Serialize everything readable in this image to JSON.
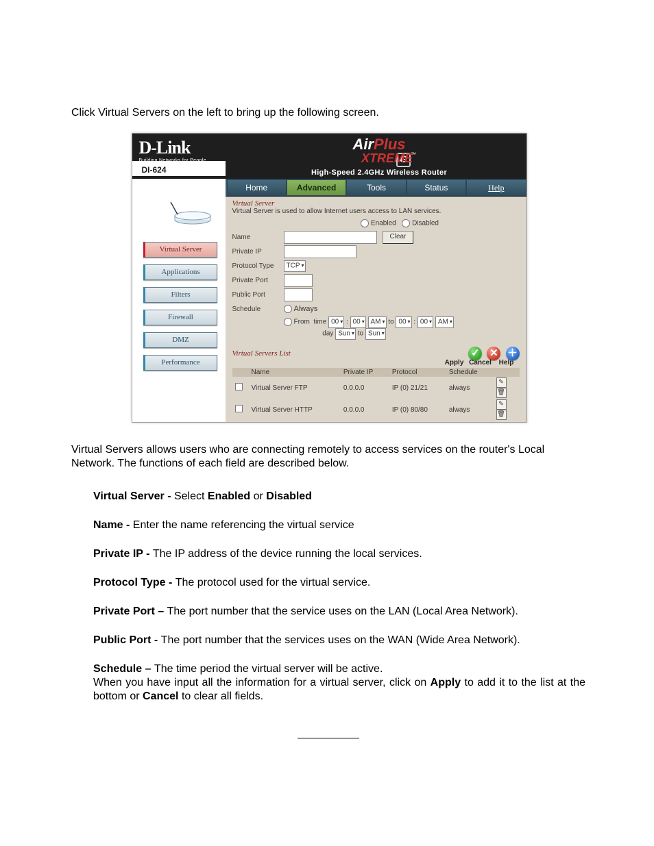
{
  "intro": "Click Virtual Servers on the left to bring up the following screen.",
  "screenshot": {
    "brand_logo": "D-Link",
    "brand_tagline": "Building Networks for People",
    "product_name": {
      "air": "Air",
      "plus": "Plus",
      "xtreme": "XTREME",
      "g": "G",
      "tm": "™"
    },
    "product_subtitle": "High-Speed 2.4GHz Wireless Router",
    "model": "DI-624",
    "tabs": [
      "Home",
      "Advanced",
      "Tools",
      "Status",
      "Help"
    ],
    "active_tab": "Advanced",
    "sidebar": [
      "Virtual Server",
      "Applications",
      "Filters",
      "Firewall",
      "DMZ",
      "Performance"
    ],
    "active_sidebar": "Virtual Server",
    "section_heading": "Virtual Server",
    "section_desc": "Virtual Server is used to allow Internet users access to LAN services.",
    "radio_enabled": "Enabled",
    "radio_disabled": "Disabled",
    "labels": {
      "name": "Name",
      "private_ip": "Private IP",
      "protocol_type": "Protocol Type",
      "private_port": "Private Port",
      "public_port": "Public Port",
      "schedule": "Schedule"
    },
    "clear_btn": "Clear",
    "protocol_value": "TCP",
    "schedule": {
      "always": "Always",
      "from": "From",
      "time_label": "time",
      "h1": "00",
      "m1": "00",
      "ampm1": "AM",
      "to": "to",
      "h2": "00",
      "m2": "00",
      "ampm2": "AM",
      "day_label": "day",
      "day1": "Sun",
      "day_to": "to",
      "day2": "Sun"
    },
    "actions": {
      "apply": "Apply",
      "cancel": "Cancel",
      "help": "Help"
    },
    "list_heading": "Virtual Servers List",
    "columns": [
      "Name",
      "Private IP",
      "Protocol",
      "Schedule"
    ],
    "rows": [
      {
        "name": "Virtual Server FTP",
        "ip": "0.0.0.0",
        "protocol": "IP (0) 21/21",
        "schedule": "always"
      },
      {
        "name": "Virtual Server HTTP",
        "ip": "0.0.0.0",
        "protocol": "IP (0) 80/80",
        "schedule": "always"
      }
    ]
  },
  "desc_paragraph": "Virtual Servers allows users who are connecting remotely to access services on the router's Local Network. The functions of each field are described below.",
  "fields": {
    "vs_label": "Virtual Server - ",
    "vs_text_a": "Select ",
    "vs_text_enabled": "Enabled",
    "vs_text_or": " or ",
    "vs_text_disabled": "Disabled",
    "name_label": "Name - ",
    "name_text": "Enter the name referencing the virtual service",
    "pip_label": "Private IP - ",
    "pip_text": "The IP address of the device running the local services.",
    "proto_label": "Protocol Type - ",
    "proto_text": "The protocol used for the virtual service.",
    "pport_label": "Private Port – ",
    "pport_text": "The port number that the service uses on the LAN (Local Area Network).",
    "pubport_label": "Public Port - ",
    "pubport_text": "The port number that the services uses on the WAN (Wide Area Network).",
    "sched_label": "Schedule – ",
    "sched_text": "The time period the virtual server will be active.",
    "footer_a": "When you have input all the information for a virtual server, click on ",
    "footer_apply": "Apply",
    "footer_b": " to add it to the list at the bottom or ",
    "footer_cancel": "Cancel",
    "footer_c": " to clear all fields."
  }
}
